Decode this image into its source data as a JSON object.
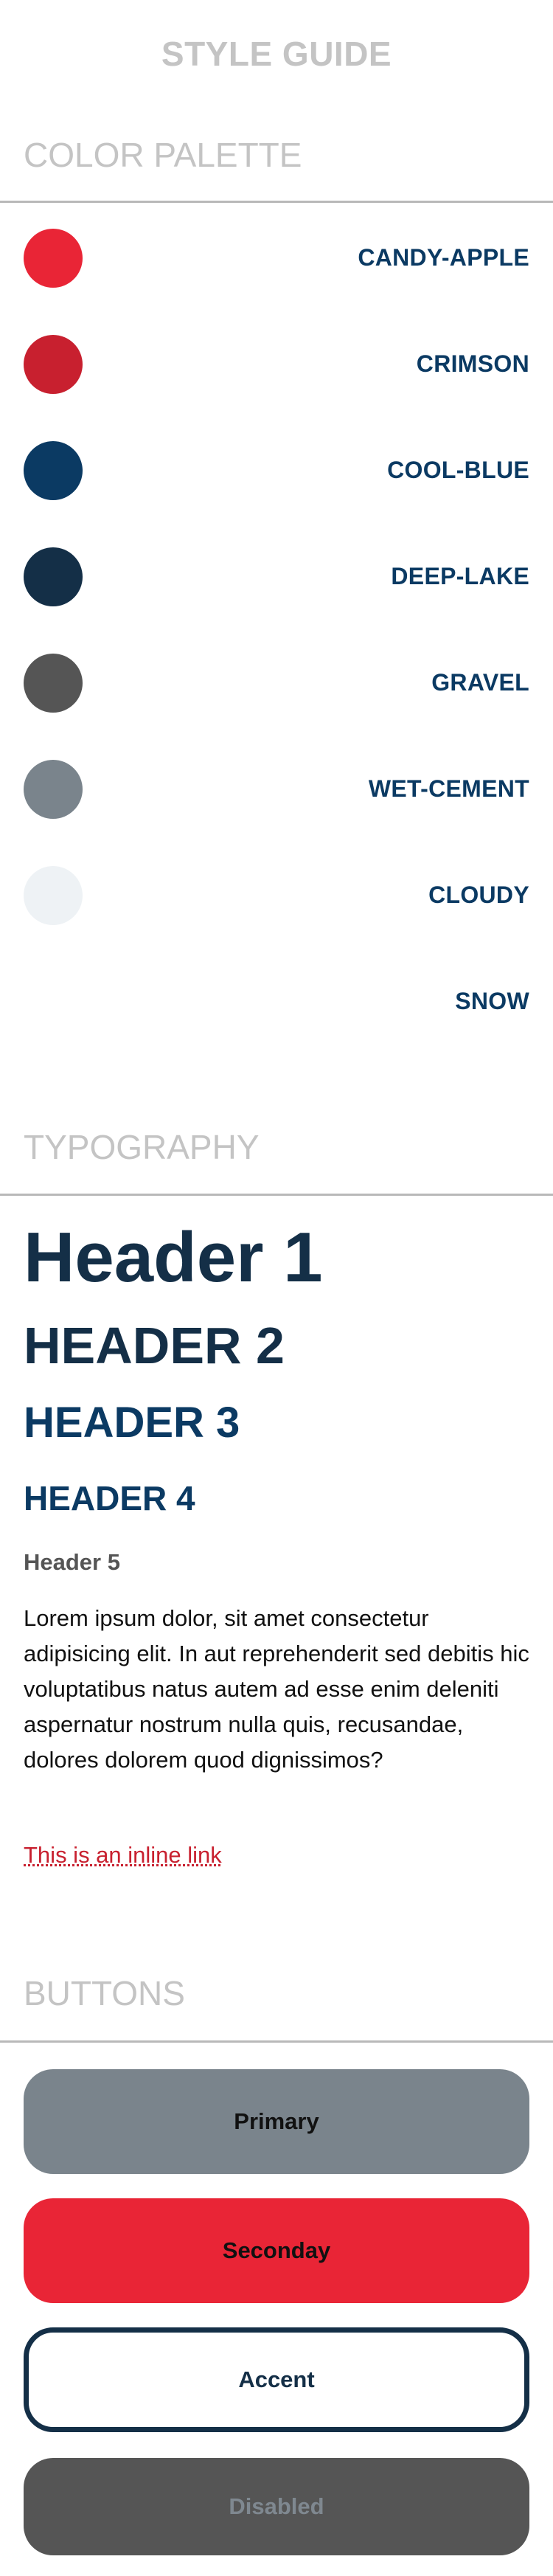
{
  "page": {
    "title": "STYLE GUIDE"
  },
  "sections": {
    "color_palette": "COLOR PALETTE",
    "typography": "TYPOGRAPHY",
    "buttons": "BUTTONS"
  },
  "colors": [
    {
      "name": "CANDY-APPLE",
      "hex": "#e92536"
    },
    {
      "name": "CRIMSON",
      "hex": "#c8202f"
    },
    {
      "name": "COOL-BLUE",
      "hex": "#0b3a63"
    },
    {
      "name": "DEEP-LAKE",
      "hex": "#142f47"
    },
    {
      "name": "GRAVEL",
      "hex": "#555555"
    },
    {
      "name": "WET-CEMENT",
      "hex": "#7a848c"
    },
    {
      "name": "CLOUDY",
      "hex": "#eef2f5"
    },
    {
      "name": "SNOW",
      "hex": "#ffffff"
    }
  ],
  "typography": {
    "h1": "Header 1",
    "h2": "HEADER 2",
    "h3": "HEADER 3",
    "h4": "HEADER 4",
    "h5": "Header 5",
    "body": "Lorem ipsum dolor, sit amet consectetur adipisicing elit. In aut reprehenderit sed debitis hic voluptatibus natus autem ad esse enim deleniti aspernatur nostrum nulla quis, recusandae, dolores dolorem quod dignissimos?",
    "link": "This is an inline link"
  },
  "buttons": {
    "primary": "Primary",
    "secondary": "Seconday",
    "accent": "Accent",
    "disabled": "Disabled"
  }
}
